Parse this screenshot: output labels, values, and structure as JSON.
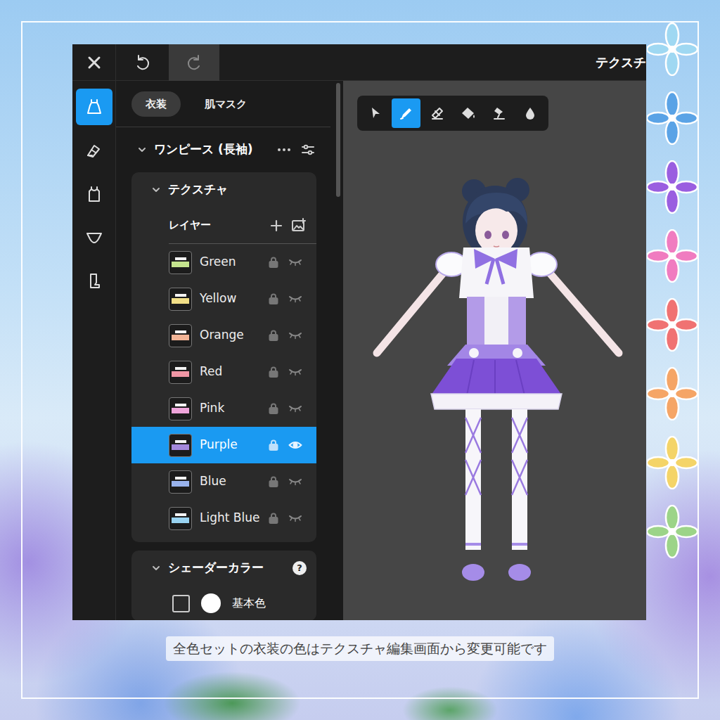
{
  "window": {
    "title": "テクスチ"
  },
  "history": {
    "undo": {
      "disabled": false
    },
    "redo": {
      "disabled": true
    }
  },
  "rail": [
    {
      "selected": true
    },
    {
      "selected": false
    },
    {
      "selected": false
    },
    {
      "selected": false
    },
    {
      "selected": false
    }
  ],
  "tabs": [
    {
      "label": "衣装",
      "selected": true
    },
    {
      "label": "肌マスク",
      "selected": false
    }
  ],
  "section": {
    "title": "ワンピース (長袖)",
    "expanded": true
  },
  "texture": {
    "title": "テクスチャ",
    "expanded": true,
    "layers_label": "レイヤー",
    "layers": [
      {
        "name": "Green",
        "selected": false,
        "visible": false,
        "locked": false,
        "color": "#c5e48e"
      },
      {
        "name": "Yellow",
        "selected": false,
        "visible": false,
        "locked": false,
        "color": "#f1de86"
      },
      {
        "name": "Orange",
        "selected": false,
        "visible": false,
        "locked": false,
        "color": "#f2b496"
      },
      {
        "name": "Red",
        "selected": false,
        "visible": false,
        "locked": false,
        "color": "#f096a4"
      },
      {
        "name": "Pink",
        "selected": false,
        "visible": false,
        "locked": false,
        "color": "#eea4da"
      },
      {
        "name": "Purple",
        "selected": true,
        "visible": true,
        "locked": false,
        "color": "#a488dc"
      },
      {
        "name": "Blue",
        "selected": false,
        "visible": false,
        "locked": false,
        "color": "#98b2ec"
      },
      {
        "name": "Light Blue",
        "selected": false,
        "visible": false,
        "locked": false,
        "color": "#98d2f0"
      }
    ]
  },
  "shader": {
    "title": "シェーダーカラー",
    "help": "?",
    "expanded": true,
    "rows": [
      {
        "label": "基本色",
        "checked": false,
        "color": "#ffffff"
      }
    ]
  },
  "tools": [
    {
      "selected": false
    },
    {
      "selected": true
    },
    {
      "selected": false
    },
    {
      "selected": false
    },
    {
      "selected": false
    },
    {
      "selected": false
    }
  ],
  "decorations": [
    {
      "color": "#9fd8f2"
    },
    {
      "color": "#5aa3e6"
    },
    {
      "color": "#9a5ee0"
    },
    {
      "color": "#f07cc0"
    },
    {
      "color": "#f07272"
    },
    {
      "color": "#f5a566"
    },
    {
      "color": "#f4d468"
    },
    {
      "color": "#9cd488"
    }
  ],
  "caption": "全色セットの衣装の色はテクスチャ編集画面から変更可能です"
}
